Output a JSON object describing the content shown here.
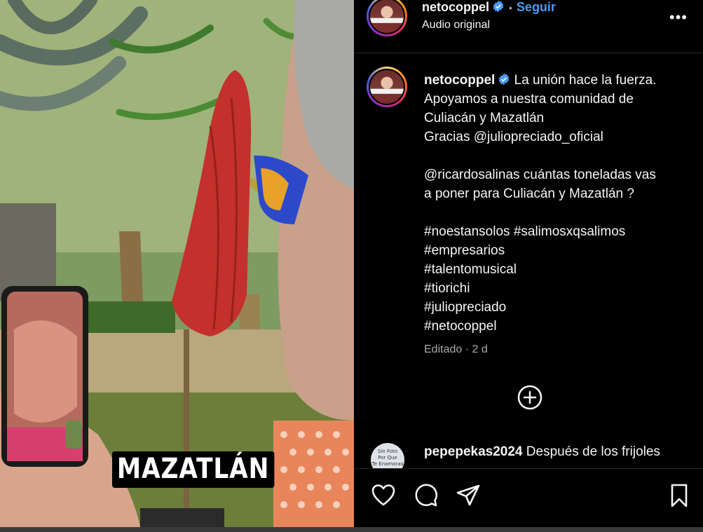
{
  "media": {
    "caption": "MAZATLÁN",
    "phone_screen_text": "",
    "color_umbrella": "#c4302b",
    "color_glasses": "#2c49c9"
  },
  "header": {
    "username": "netocoppel",
    "verified_icon": "verified-badge-icon",
    "separator": "•",
    "follow_label": "Seguir",
    "subtitle": "Audio original",
    "more_icon": "more-horizontal-icon",
    "more_glyph": "•••"
  },
  "post": {
    "username": "netocoppel",
    "lines": [
      "La unión hace la fuerza.",
      "Apoyamos a nuestra comunidad de",
      "Culiacán y Mazatlán",
      "Gracias @juliopreciado_oficial"
    ],
    "lines2": [
      "@ricardosalinas cuántas toneladas vas",
      "a poner para Culiacán y Mazatlán ?"
    ],
    "hashtags": [
      "#noestansolos #salimosxqsalimos",
      "#empresarios",
      "#talentomusical",
      "#tiorichi",
      "#juliopreciado",
      "#netocoppel"
    ],
    "edited": "Editado · 2 d"
  },
  "comment": {
    "username": "pepepekas2024",
    "text": "Después de los frijoles",
    "avatar_lines": [
      "Sin Foto",
      "Por Que",
      "Te Enamoras"
    ]
  },
  "actions": {
    "like_icon": "heart-icon",
    "comment_icon": "comment-icon",
    "share_icon": "share-icon",
    "save_icon": "bookmark-icon",
    "add_icon": "add-circle-icon"
  },
  "colors": {
    "accent": "#4a9cf5",
    "background": "#000000",
    "muted": "#a8a8a8"
  }
}
